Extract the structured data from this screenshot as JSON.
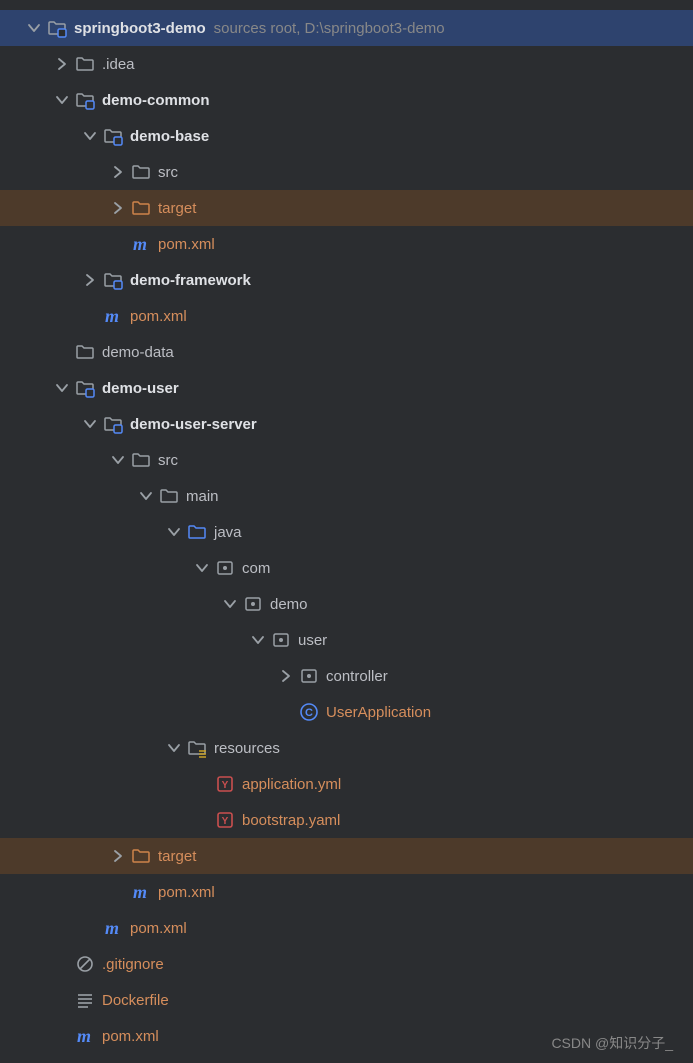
{
  "colors": {
    "gray": "#9aa0a6",
    "orange": "#ce834a",
    "blue": "#548af7",
    "yellow": "#c9a227",
    "white": "#dfe1e5"
  },
  "root": {
    "label": "springboot3-demo",
    "extra": "sources root,  D:\\springboot3-demo"
  },
  "items": {
    "idea": ".idea",
    "demo_common": "demo-common",
    "demo_base": "demo-base",
    "src1": "src",
    "target1": "target",
    "pom1": "pom.xml",
    "demo_framework": "demo-framework",
    "pom2": "pom.xml",
    "demo_data": "demo-data",
    "demo_user": "demo-user",
    "demo_user_server": "demo-user-server",
    "src2": "src",
    "main": "main",
    "java": "java",
    "com": "com",
    "demo": "demo",
    "user": "user",
    "controller": "controller",
    "user_application": "UserApplication",
    "resources": "resources",
    "app_yml": "application.yml",
    "boot_yaml": "bootstrap.yaml",
    "target2": "target",
    "pom3": "pom.xml",
    "pom4": "pom.xml",
    "gitignore": ".gitignore",
    "dockerfile": "Dockerfile",
    "pom5": "pom.xml"
  },
  "watermark": "CSDN @知识分子_"
}
